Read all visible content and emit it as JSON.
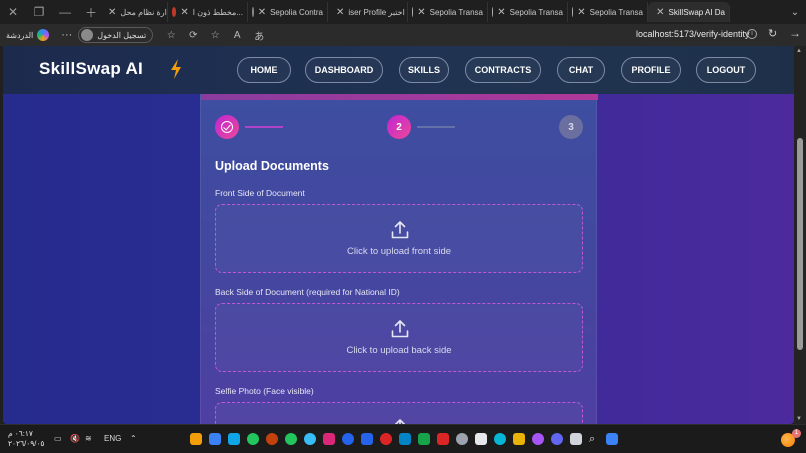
{
  "browser": {
    "tabs": [
      {
        "title": "إدارة نظام محل",
        "active": false
      },
      {
        "title": "مخطط ذون ا...",
        "active": false
      },
      {
        "title": "Sepolia Contra",
        "active": false
      },
      {
        "title": "iser Profile اختبر",
        "active": false
      },
      {
        "title": "Sepolia Transa",
        "active": false
      },
      {
        "title": "Sepolia Transa",
        "active": false
      },
      {
        "title": "Sepolia Transa",
        "active": false
      },
      {
        "title": "SkillSwap AI Da",
        "active": true
      }
    ],
    "chat_label": "الدردشة",
    "signin_label": "تسجيل الدخول",
    "url": "localhost:5173/verify-identity"
  },
  "app": {
    "brand": "SkillSwap AI",
    "nav": [
      "HOME",
      "DASHBOARD",
      "SKILLS",
      "CONTRACTS",
      "CHAT",
      "PROFILE",
      "LOGOUT"
    ]
  },
  "verify": {
    "steps": [
      "1",
      "2",
      "3"
    ],
    "current_step": 2,
    "heading": "Upload Documents",
    "sections": [
      {
        "label": "Front Side of Document",
        "prompt": "Click to upload front side"
      },
      {
        "label": "Back Side of Document (required for National ID)",
        "prompt": "Click to upload back side"
      },
      {
        "label": "Selfie Photo (Face visible)",
        "prompt": ""
      }
    ]
  },
  "taskbar": {
    "time": "٠٦:١٧ م",
    "date": "٢٠٢٦/٠٩/٠٥",
    "lang": "ENG",
    "notifications": "1"
  },
  "colors": {
    "accent": "#c026d3",
    "accent2": "#ec4899",
    "nav_bg": "#1e3049",
    "page_bg": "#2a2c92"
  }
}
